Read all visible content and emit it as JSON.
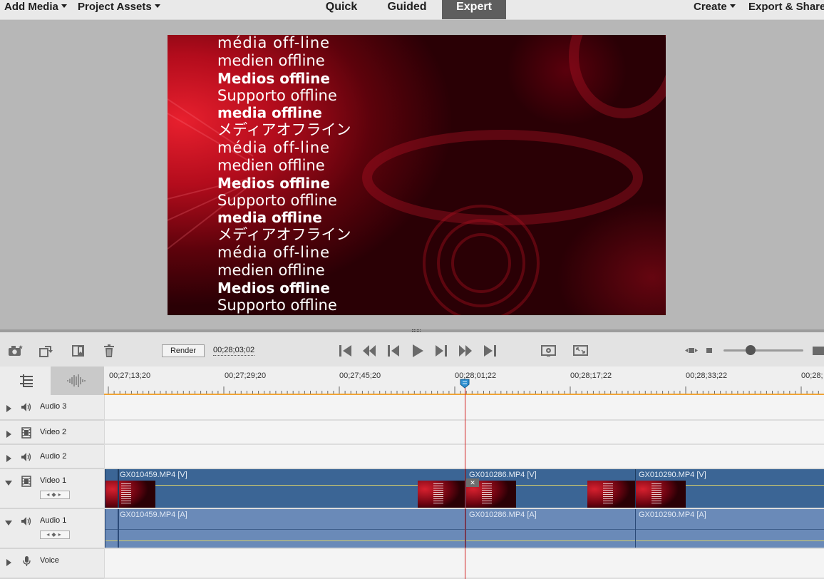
{
  "menu": {
    "add_media": "Add Media",
    "project_assets": "Project Assets",
    "create": "Create",
    "export_share": "Export & Share"
  },
  "modes": [
    "Quick",
    "Guided",
    "Expert"
  ],
  "active_mode": "Expert",
  "monitor": {
    "offline_lines": [
      "média off-line",
      "medien offline",
      "Medios offline",
      "Supporto offline",
      "media offline",
      "メディアオフライン",
      "média off-line",
      "medien offline",
      "Medios offline",
      "Supporto offline",
      "media offline",
      "メディアオフライン",
      "média off-line",
      "medien offline",
      "Medios offline",
      "Supporto offline"
    ]
  },
  "toolbar": {
    "render_label": "Render",
    "current_timecode": "00;28;03;02",
    "icons": [
      "camera-icon",
      "rotate-icon",
      "marker-icon",
      "trash-icon",
      "go-to-start-icon",
      "step-back-icon",
      "frame-back-icon",
      "play-icon",
      "frame-forward-icon",
      "step-forward-icon",
      "go-to-end-icon",
      "render-settings-icon",
      "fullscreen-icon",
      "zoom-out-icon",
      "zoom-in-icon"
    ]
  },
  "ruler": {
    "labels": [
      "00;27;13;20",
      "00;27;29;20",
      "00;27;45;20",
      "00;28;01;22",
      "00;28;17;22",
      "00;28;33;22",
      "00;28;"
    ]
  },
  "tracks": [
    {
      "name": "Audio 3",
      "type": "audio"
    },
    {
      "name": "Video 2",
      "type": "video"
    },
    {
      "name": "Audio 2",
      "type": "audio"
    },
    {
      "name": "Video 1",
      "type": "video"
    },
    {
      "name": "Audio 1",
      "type": "audio"
    },
    {
      "name": "Voice",
      "type": "voice"
    }
  ],
  "clips": {
    "video": [
      "GX010459.MP4 [V]",
      "GX010286.MP4 [V]",
      "GX010290.MP4 [V]"
    ],
    "audio": [
      "GX010459.MP4 [A]",
      "GX010286.MP4 [A]",
      "GX010290.MP4 [A]"
    ]
  },
  "colors": {
    "video_clip": "#3b6595",
    "audio_clip": "#6a8ab8",
    "playhead": "#d42323",
    "ruler_accent": "#f0a436",
    "active_mode_bg": "#5e5e5e"
  }
}
